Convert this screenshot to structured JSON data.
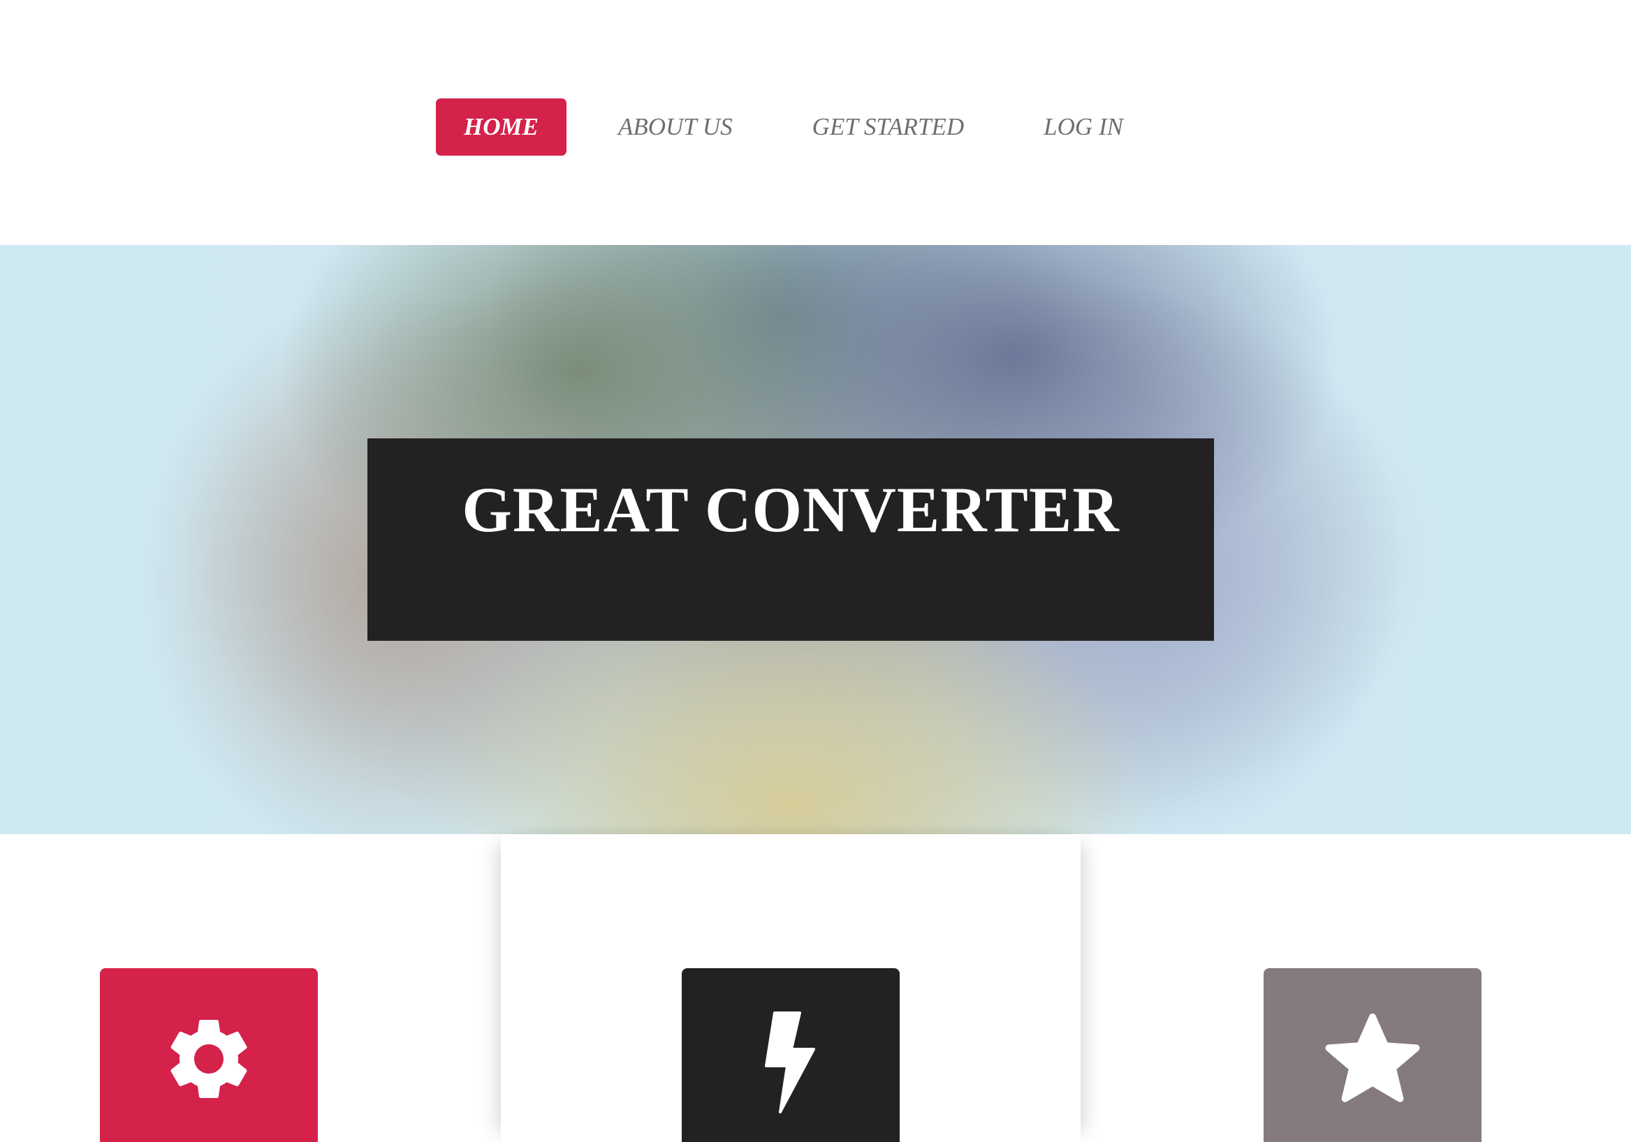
{
  "nav": {
    "items": [
      {
        "label": "HOME",
        "active": true
      },
      {
        "label": "ABOUT US",
        "active": false
      },
      {
        "label": "GET STARTED",
        "active": false
      },
      {
        "label": "LOG IN",
        "active": false
      }
    ]
  },
  "hero": {
    "title": "GREAT CONVERTER"
  },
  "features": [
    {
      "icon": "gear-icon",
      "color": "#d4224a"
    },
    {
      "icon": "lightning-bolt-icon",
      "color": "#242123"
    },
    {
      "icon": "star-icon",
      "color": "#857b7e"
    }
  ],
  "colors": {
    "accent": "#d4224a",
    "dark": "#242123",
    "muted": "#857b7e",
    "nav_text": "#6f6f6f"
  }
}
